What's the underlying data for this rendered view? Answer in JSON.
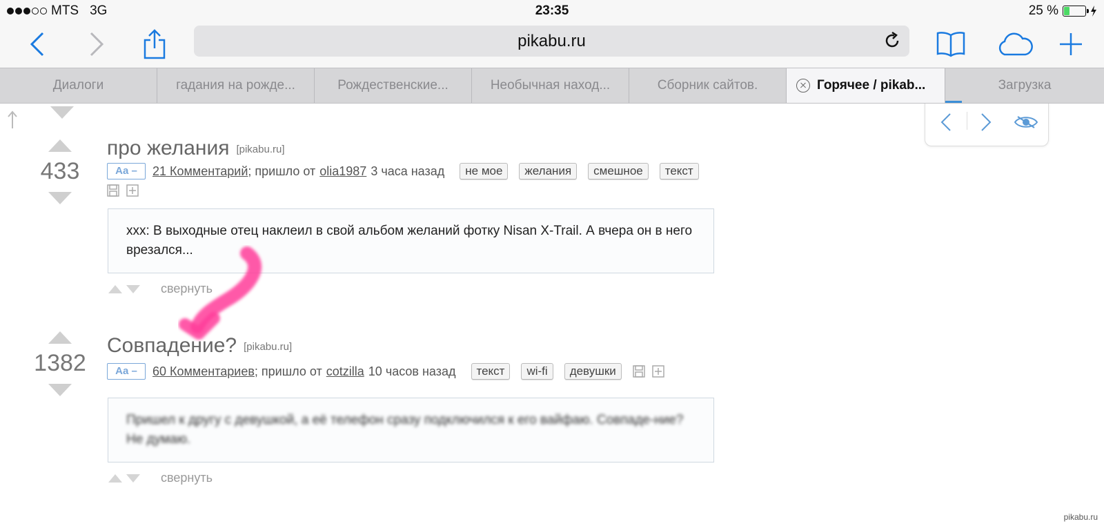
{
  "status": {
    "carrier": "MTS",
    "network": "3G",
    "time": "23:35",
    "battery_text": "25 %",
    "battery_level": 0.25
  },
  "browser": {
    "url": "pikabu.ru",
    "tabs": [
      {
        "label": "Диалоги"
      },
      {
        "label": "гадания на рожде..."
      },
      {
        "label": "Рождественские..."
      },
      {
        "label": "Необычная наход..."
      },
      {
        "label": "Сборник сайтов."
      },
      {
        "label": "Горячее / pikab..."
      },
      {
        "label": "Загрузка"
      }
    ]
  },
  "posts": [
    {
      "rating": "433",
      "title": "про желания",
      "source": "[pikabu.ru]",
      "aa_label": "Aa –",
      "comments": "21 Комментарий",
      "from_text": "; пришло от",
      "author": "olia1987",
      "time": "3 часа назад",
      "tags": [
        "не мое",
        "желания",
        "смешное",
        "текст"
      ],
      "body": "xxx: В выходные отец наклеил в свой альбом желаний фотку Nisan X-Trail. А вчера он в него врезался...",
      "collapse": "свернуть"
    },
    {
      "rating": "1382",
      "title": "Совпадение?",
      "source": "[pikabu.ru]",
      "aa_label": "Aa –",
      "comments": "60 Комментариев",
      "from_text": "; пришло от",
      "author": "cotzilla",
      "time": "10 часов назад",
      "tags": [
        "текст",
        "wi-fi",
        "девушки"
      ],
      "body": "Пришел к другу с девушкой, а её телефон сразу подключился к его вайфаю. Совпаде-ние? Не думаю.",
      "collapse": "свернуть"
    }
  ],
  "watermark": "pikabu.ru",
  "colors": {
    "accent": "#3b8fd8",
    "annotation_arrow": "#ff3d9a",
    "battery": "#4cd964"
  }
}
